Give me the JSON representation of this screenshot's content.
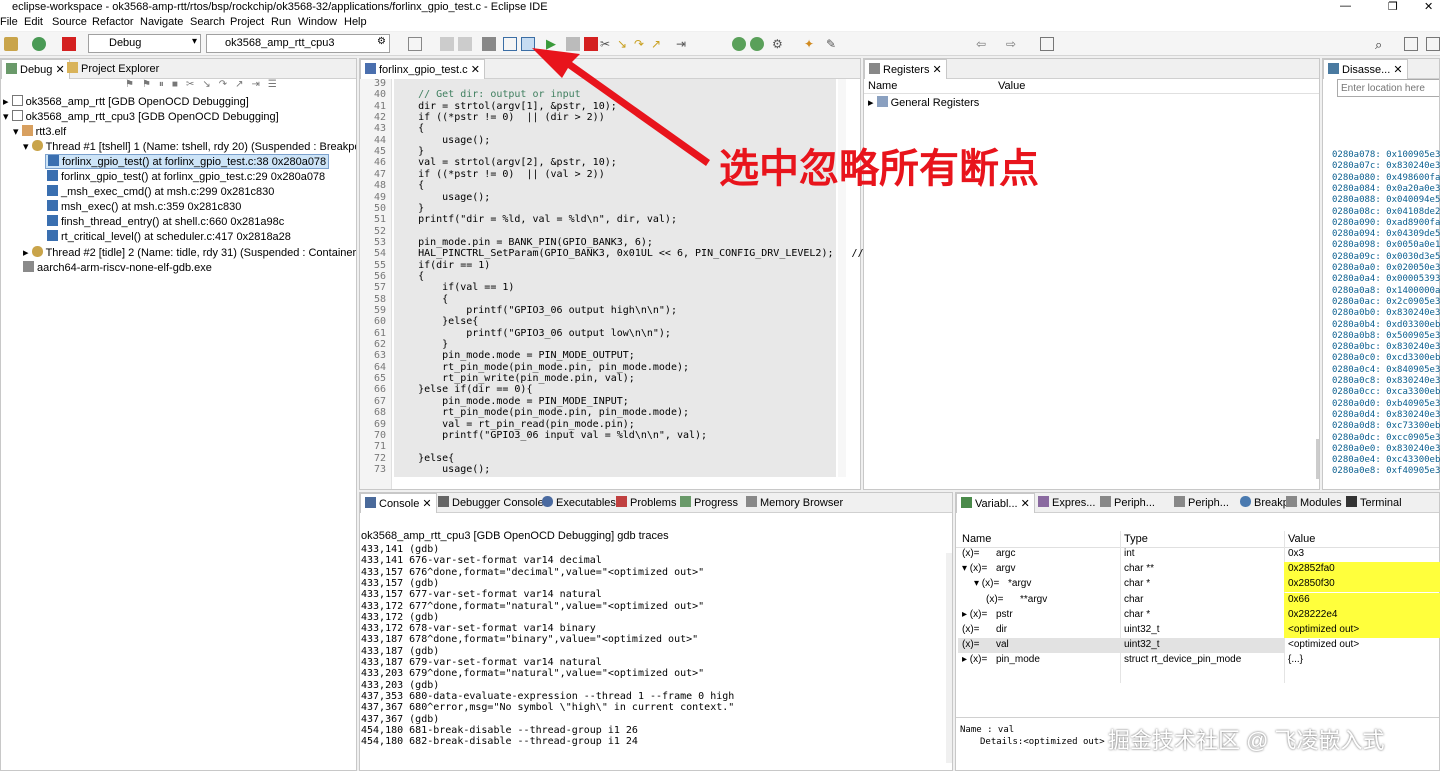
{
  "window": {
    "title": "eclipse-workspace - ok3568-amp-rtt/rtos/bsp/rockchip/ok3568-32/applications/forlinx_gpio_test.c - Eclipse IDE",
    "controls": [
      "—",
      "❐",
      "✕"
    ]
  },
  "menu": [
    "File",
    "Edit",
    "Source",
    "Refactor",
    "Navigate",
    "Search",
    "Project",
    "Run",
    "Window",
    "Help"
  ],
  "toolbar": {
    "mode_combo": "Debug",
    "config_combo": "ok3568_amp_rtt_cpu3"
  },
  "debug_view": {
    "tabs": [
      "Debug",
      "Project Explorer"
    ],
    "tree": [
      "ok3568_amp_rtt [GDB OpenOCD Debugging]",
      "ok3568_amp_rtt_cpu3 [GDB OpenOCD Debugging]",
      "rtt3.elf",
      "Thread #1 [tshell] 1 (Name: tshell, rdy 20) (Suspended : Breakpoint)",
      "forlinx_gpio_test() at forlinx_gpio_test.c:38 0x280a078",
      "forlinx_gpio_test() at forlinx_gpio_test.c:29 0x280a078",
      "_msh_exec_cmd() at msh.c:299 0x281c830",
      "msh_exec() at msh.c:359 0x281c830",
      "finsh_thread_entry() at shell.c:660 0x281a98c",
      "rt_critical_level() at scheduler.c:417 0x2818a28",
      "Thread #2 [tidle] 2 (Name: tidle, rdy 31) (Suspended : Container)",
      "aarch64-arm-riscv-none-elf-gdb.exe"
    ]
  },
  "editor": {
    "tab": "forlinx_gpio_test.c",
    "line_numbers": [
      "39",
      "40",
      "41",
      "42",
      "43",
      "44",
      "45",
      "46",
      "47",
      "48",
      "49",
      "50",
      "51",
      "52",
      "53",
      "54",
      "55",
      "56",
      "57",
      "58",
      "59",
      "60",
      "61",
      "62",
      "63",
      "64",
      "65",
      "66",
      "67",
      "68",
      "69",
      "70",
      "71",
      "72",
      "73"
    ],
    "lines": [
      "",
      "    // Get dir: output or input",
      "    dir = strtol(argv[1], &pstr, 10);",
      "    if ((*pstr != 0)  || (dir > 2))",
      "    {",
      "        usage();",
      "    }",
      "    val = strtol(argv[2], &pstr, 10);",
      "    if ((*pstr != 0)  || (val > 2))",
      "    {",
      "        usage();",
      "    }",
      "    printf(\"dir = %ld, val = %ld\\n\", dir, val);",
      "",
      "    pin_mode.pin = BANK_PIN(GPIO_BANK3, 6);",
      "    HAL_PINCTRL_SetParam(GPIO_BANK3, 0x01UL << 6, PIN_CONFIG_DRV_LEVEL2);   //8",
      "    if(dir == 1)",
      "    {",
      "        if(val == 1)",
      "        {",
      "            printf(\"GPIO3_06 output high\\n\\n\");",
      "        }else{",
      "            printf(\"GPIO3_06 output low\\n\\n\");",
      "        }",
      "        pin_mode.mode = PIN_MODE_OUTPUT;",
      "        rt_pin_mode(pin_mode.pin, pin_mode.mode);",
      "        rt_pin_write(pin_mode.pin, val);",
      "    }else if(dir == 0){",
      "        pin_mode.mode = PIN_MODE_INPUT;",
      "        rt_pin_mode(pin_mode.pin, pin_mode.mode);",
      "        val = rt_pin_read(pin_mode.pin);",
      "        printf(\"GPIO3_06 input val = %ld\\n\\n\", val);",
      "",
      "    }else{",
      "        usage();"
    ]
  },
  "registers": {
    "tab": "Registers",
    "columns": [
      "Name",
      "Value"
    ],
    "rows": [
      "General Registers"
    ]
  },
  "disassembly": {
    "tab": "Disasse...",
    "location_placeholder": "Enter location here",
    "rows": [
      "0280a078: 0x100905e3",
      "0280a07c: 0x830240e3",
      "0280a080: 0x498600fa",
      "0280a084: 0x0a20a0e3",
      "0280a088: 0x040094e5",
      "0280a08c: 0x04108de2",
      "0280a090: 0xad8900fa",
      "0280a094: 0x04309de5",
      "0280a098: 0x0050a0e1",
      "0280a09c: 0x0030d3e5",
      "0280a0a0: 0x020050e3",
      "0280a0a4: 0x00005393",
      "0280a0a8: 0x1400000a",
      "0280a0ac: 0x2c0905e3",
      "0280a0b0: 0x830240e3",
      "0280a0b4: 0xd03300eb",
      "0280a0b8: 0x500905e3",
      "0280a0bc: 0x830240e3",
      "0280a0c0: 0xcd3300eb",
      "0280a0c4: 0x840905e3",
      "0280a0c8: 0x830240e3",
      "0280a0cc: 0xca3300eb",
      "0280a0d0: 0xb40905e3",
      "0280a0d4: 0x830240e3",
      "0280a0d8: 0xc73300eb",
      "0280a0dc: 0xcc0905e3",
      "0280a0e0: 0x830240e3",
      "0280a0e4: 0xc43300eb",
      "0280a0e8: 0xf40905e3"
    ]
  },
  "console": {
    "tabs": [
      "Console",
      "Debugger Console",
      "Executables",
      "Problems",
      "Progress",
      "Memory Browser"
    ],
    "header": "ok3568_amp_rtt_cpu3 [GDB OpenOCD Debugging] gdb traces",
    "lines": [
      "433,141 (gdb)",
      "433,141 676-var-set-format var14 decimal",
      "433,157 676^done,format=\"decimal\",value=\"<optimized out>\"",
      "433,157 (gdb)",
      "433,157 677-var-set-format var14 natural",
      "433,172 677^done,format=\"natural\",value=\"<optimized out>\"",
      "433,172 (gdb)",
      "433,172 678-var-set-format var14 binary",
      "433,187 678^done,format=\"binary\",value=\"<optimized out>\"",
      "433,187 (gdb)",
      "433,187 679-var-set-format var14 natural",
      "433,203 679^done,format=\"natural\",value=\"<optimized out>\"",
      "433,203 (gdb)",
      "437,353 680-data-evaluate-expression --thread 1 --frame 0 high",
      "437,367 680^error,msg=\"No symbol \\\"high\\\" in current context.\"",
      "437,367 (gdb)",
      "454,180 681-break-disable --thread-group i1 26",
      "454,180 682-break-disable --thread-group i1 24"
    ]
  },
  "variables": {
    "tabs": [
      "Variabl...",
      "Expres...",
      "Periph...",
      "Periph...",
      "Breakp...",
      "Modules",
      "Terminal"
    ],
    "columns": [
      "Name",
      "Type",
      "Value"
    ],
    "rows": [
      {
        "name": "argc",
        "type": "int",
        "value": "0x3",
        "changed": false
      },
      {
        "name": "argv",
        "type": "char **",
        "value": "0x2852fa0",
        "changed": true
      },
      {
        "name": "*argv",
        "type": "char *",
        "value": "0x2850f30",
        "changed": true
      },
      {
        "name": "**argv",
        "type": "char",
        "value": "0x66",
        "changed": true
      },
      {
        "name": "pstr",
        "type": "char *",
        "value": "0x28222e4",
        "changed": true
      },
      {
        "name": "dir",
        "type": "uint32_t",
        "value": "<optimized out>",
        "changed": true
      },
      {
        "name": "val",
        "type": "uint32_t",
        "value": "<optimized out>",
        "changed": false
      },
      {
        "name": "pin_mode",
        "type": "struct rt_device_pin_mode",
        "value": "{...}",
        "changed": false
      }
    ],
    "detail_name": "Name : val",
    "detail_text": "Details:<optimized out>"
  },
  "annotation": "选中忽略所有断点",
  "watermark": "掘金技术社区 @ 飞凌嵌入式",
  "colors": {
    "highlight": "#ffff3c",
    "annotation": "#e8141c",
    "keyword": "#7f0055",
    "string": "#2a00ff",
    "comment": "#3f7f5f"
  }
}
